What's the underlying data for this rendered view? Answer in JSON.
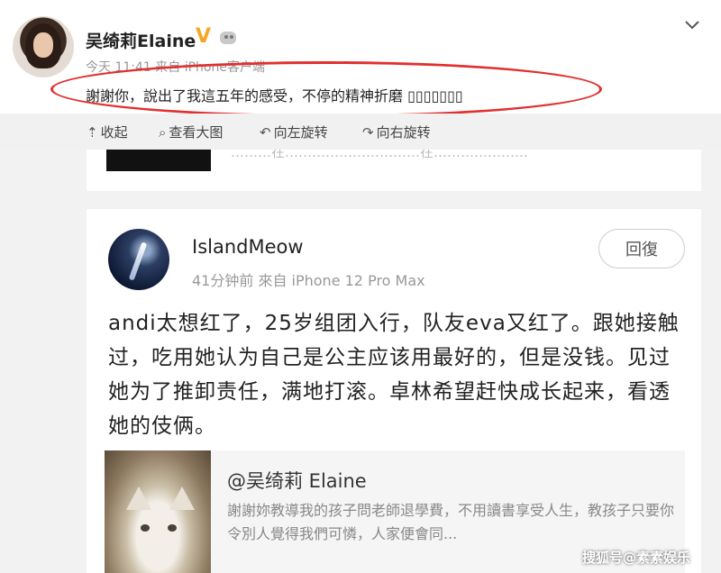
{
  "top_post": {
    "author": "吴绮莉Elaine",
    "meta": "今天 11:41 来自 iPhone客户端",
    "text": "謝謝你，說出了我這五年的感受，不停的精神折磨 ▯▯▯▯▯▯▯",
    "verify_icon": "v-badge-icon",
    "highlight_color": "#e0302f"
  },
  "toolbar": {
    "items": [
      {
        "icon": "collapse-up-icon",
        "label": "收起"
      },
      {
        "icon": "search-icon",
        "label": "查看大图"
      },
      {
        "icon": "rotate-left-icon",
        "label": "向左旋转"
      },
      {
        "icon": "rotate-right-icon",
        "label": "向右旋转"
      }
    ]
  },
  "prev_card": {
    "faded_text": "………在…………………………在…………………"
  },
  "comment": {
    "username": "IslandMeow",
    "meta": "41分钟前  來自 iPhone 12 Pro Max",
    "reply_label": "回復",
    "body": "andi太想红了，25岁组团入行，队友eva又红了。跟她接触过，吃用她认为自己是公主应该用最好的，但是没钱。见过她为了推卸责任，满地打滚。卓林希望赶快成长起来，看透她的伎俩。",
    "quote": {
      "title": "@吴绮莉 Elaine",
      "text": "謝謝妳教導我的孩子問老師退學費，不用讀書享受人生，教孩子只要你令別人覺得我們可憐，人家便會同..."
    }
  },
  "watermark": "搜狐号@素素娱乐"
}
